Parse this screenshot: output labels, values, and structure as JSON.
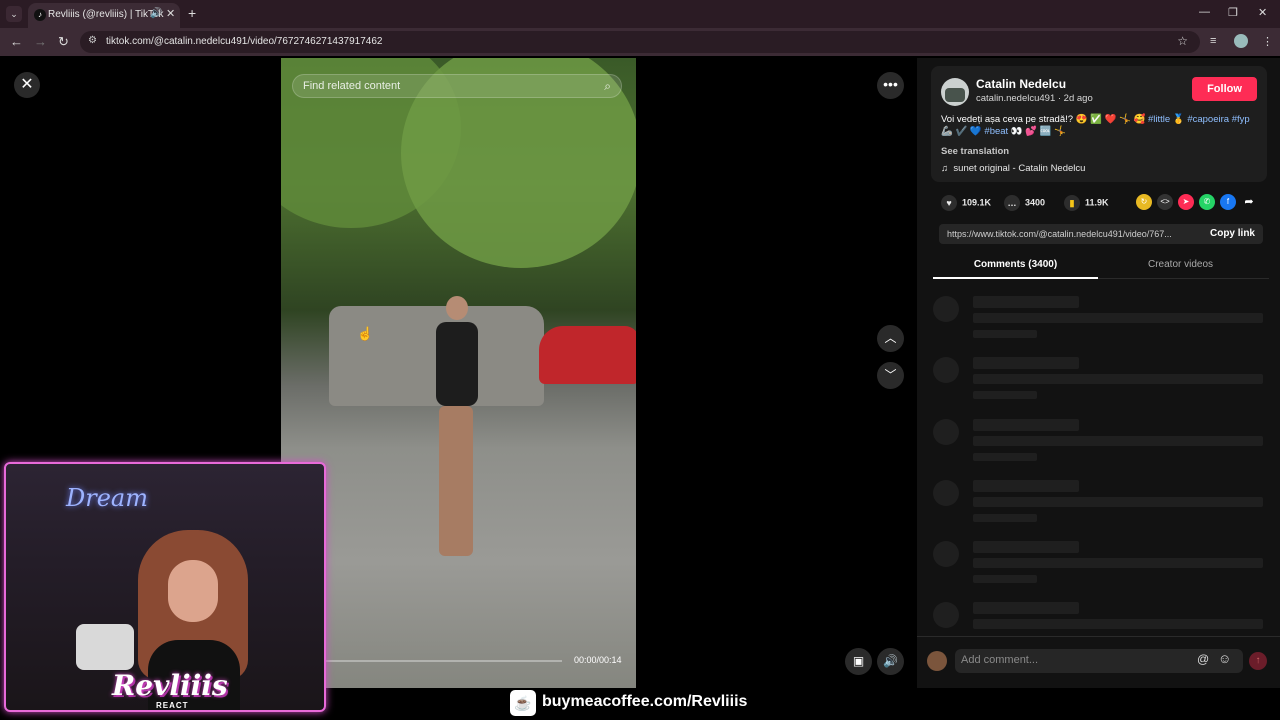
{
  "browser": {
    "tab_title": "Revliiis (@revliiis) | TikTok",
    "url": "tiktok.com/@catalin.nedelcu491/video/7672746271437917462",
    "icons": [
      "back-icon",
      "forward-icon",
      "reload-icon",
      "bookmark-star-icon",
      "minimize-icon",
      "maximize-icon",
      "close-icon"
    ]
  },
  "video": {
    "find_related": "Find related content",
    "timecode": "00:00/00:14",
    "progress_fraction": 0.0
  },
  "post": {
    "author_name": "Catalin Nedelcu",
    "author_meta": "catalin.nedelcu491 · 2d ago",
    "follow_label": "Follow",
    "description_text": "Voi vedeți așa ceva pe stradă!? 😍 ✅ ❤️ 🤸 🥰",
    "description_tags": [
      "#little",
      "#capoeira",
      "#fyp",
      "#beat"
    ],
    "description_emoji_1": "🥇",
    "description_emoji_2": "🦾 ✔️ 💙",
    "description_emoji_3": "👀 💕 🆒 🤸",
    "see_translation": "See translation",
    "sound": "sunet original - Catalin Nedelcu"
  },
  "stats": {
    "likes": "109.1K",
    "comments": "3400",
    "saves": "11.9K"
  },
  "link": {
    "url": "https://www.tiktok.com/@catalin.nedelcu491/video/767...",
    "copy_label": "Copy link"
  },
  "tabs": {
    "comments": "Comments (3400)",
    "creator_videos": "Creator videos"
  },
  "comment_input": {
    "placeholder": "Add comment..."
  },
  "overlay": {
    "neon_sign": "Dream",
    "logo": "Revliiis",
    "logo_sub": "REACT",
    "coffee_link": "buymeacoffee.com/Revliiis"
  },
  "colors": {
    "follow": "#fe2c55",
    "tag": "#8fbfff",
    "webcam_border": "#e86ad9"
  }
}
